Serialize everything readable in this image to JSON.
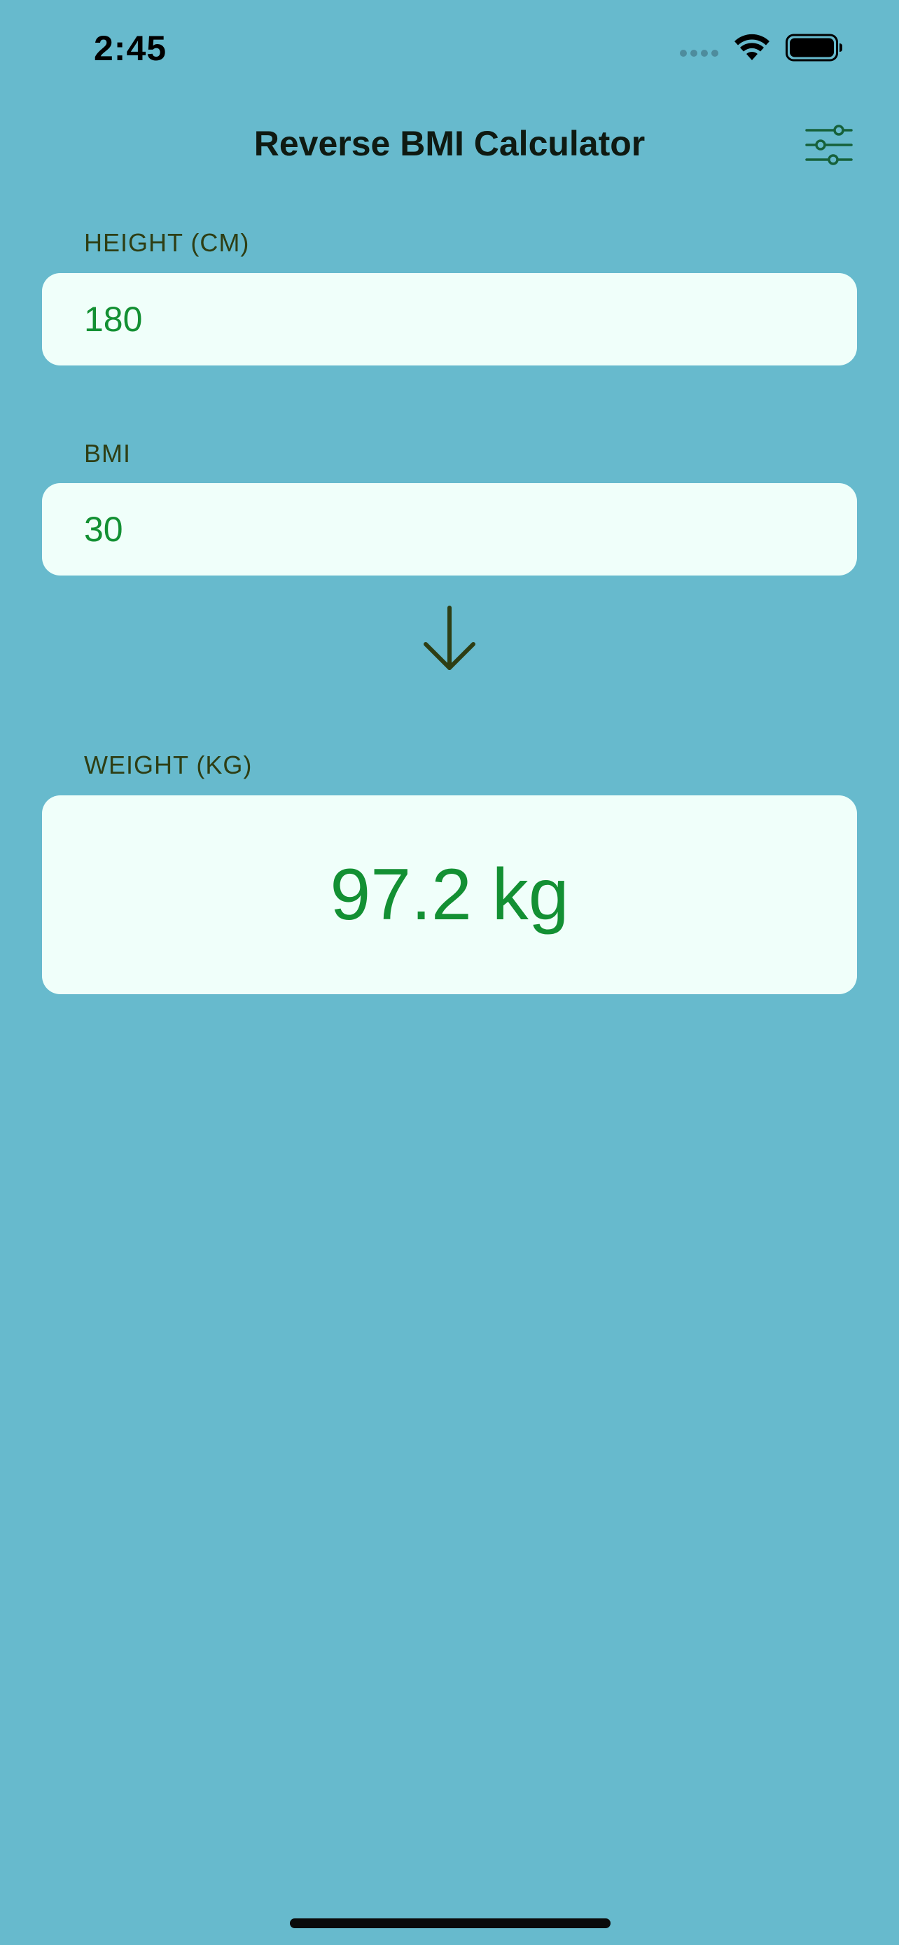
{
  "status_bar": {
    "time": "2:45",
    "icons": [
      "cellular-dots-icon",
      "wifi-icon",
      "battery-icon"
    ]
  },
  "nav": {
    "title": "Reverse BMI Calculator",
    "settings_icon": "sliders-icon"
  },
  "form": {
    "height": {
      "label": "HEIGHT (CM)",
      "value": "180"
    },
    "bmi": {
      "label": "BMI",
      "value": "30"
    },
    "arrow_icon": "arrow-down-icon"
  },
  "result": {
    "label": "WEIGHT (KG)",
    "value": "97.2 kg"
  },
  "colors": {
    "background": "#67bacd",
    "field_bg": "#f0fffa",
    "value_green": "#139033",
    "label_olive": "#2e3e14",
    "icon_green": "#16613a"
  }
}
